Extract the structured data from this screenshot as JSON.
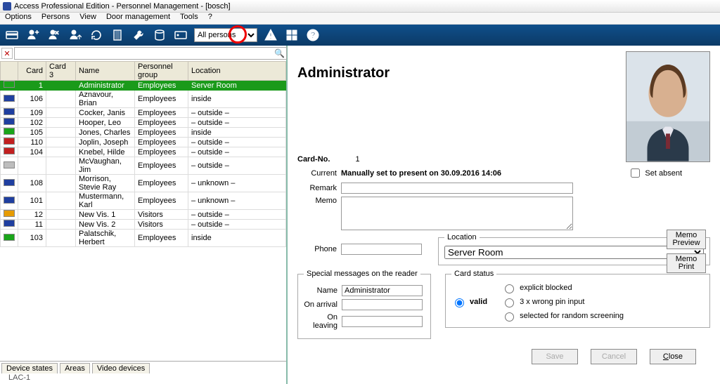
{
  "window": {
    "title": "Access Professional Edition - Personnel Management - [bosch]"
  },
  "menu": [
    "Options",
    "Persons",
    "View",
    "Door management",
    "Tools",
    "?"
  ],
  "toolbar": {
    "filter_selected": "All persons"
  },
  "columns": [
    "",
    "Card",
    "Card 3",
    "Name",
    "Personnel group",
    "Location"
  ],
  "rows": [
    {
      "sw": "#1aa51a",
      "card": "1",
      "card3": "",
      "name": "Administrator",
      "pg": "Employees",
      "loc": "Server Room",
      "sel": true
    },
    {
      "sw": "#1f3fa0",
      "card": "106",
      "card3": "",
      "name": "Aznavour, Brian",
      "pg": "Employees",
      "loc": "inside"
    },
    {
      "sw": "#1f3fa0",
      "card": "109",
      "card3": "",
      "name": "Cocker, Janis",
      "pg": "Employees",
      "loc": "– outside –"
    },
    {
      "sw": "#1f3fa0",
      "card": "102",
      "card3": "",
      "name": "Hooper, Leo",
      "pg": "Employees",
      "loc": "– outside –"
    },
    {
      "sw": "#1aa51a",
      "card": "105",
      "card3": "",
      "name": "Jones, Charles",
      "pg": "Employees",
      "loc": "inside"
    },
    {
      "sw": "#c22020",
      "card": "110",
      "card3": "",
      "name": "Joplin, Joseph",
      "pg": "Employees",
      "loc": "– outside –"
    },
    {
      "sw": "#c22020",
      "card": "104",
      "card3": "",
      "name": "Knebel, Hilde",
      "pg": "Employees",
      "loc": "– outside –"
    },
    {
      "sw": "#bdbdbd",
      "card": "",
      "card3": "",
      "name": "McVaughan, Jim",
      "pg": "Employees",
      "loc": "– outside –"
    },
    {
      "sw": "#1f3fa0",
      "card": "108",
      "card3": "",
      "name": "Morrison, Stevie Ray",
      "pg": "Employees",
      "loc": "– unknown –"
    },
    {
      "sw": "#1f3fa0",
      "card": "101",
      "card3": "",
      "name": "Mustermann, Karl",
      "pg": "Employees",
      "loc": "– unknown –"
    },
    {
      "sw": "#e69b00",
      "card": "12",
      "card3": "",
      "name": "New Vis. 1",
      "pg": "Visitors",
      "loc": "– outside –"
    },
    {
      "sw": "#1f3fa0",
      "card": "11",
      "card3": "",
      "name": "New Vis. 2",
      "pg": "Visitors",
      "loc": "– outside –"
    },
    {
      "sw": "#1aa51a",
      "card": "103",
      "card3": "",
      "name": "Palatschik, Herbert",
      "pg": "Employees",
      "loc": "inside"
    }
  ],
  "bottom_tabs": [
    "Device states",
    "Areas",
    "Video devices"
  ],
  "lac": "LAC-1",
  "detail": {
    "title": "Administrator",
    "cardno_label": "Card-No.",
    "cardno": "1",
    "current_label": "Current",
    "current_value": "Manually set to present on 30.09.2016 14:06",
    "set_absent": "Set absent",
    "remark_label": "Remark",
    "remark": "",
    "memo_label": "Memo",
    "memo": "",
    "memo_preview": "Memo\nPreview",
    "memo_print": "Memo\nPrint",
    "phone_label": "Phone",
    "phone": "",
    "location_legend": "Location",
    "location_value": "Server Room",
    "special_legend": "Special messages on the reader",
    "special_name_label": "Name",
    "special_name": "Administrator",
    "on_arrival_label": "On arrival",
    "on_arrival": "",
    "on_leaving_label": "On leaving",
    "on_leaving": "",
    "card_status_legend": "Card status",
    "valid_label": "valid",
    "cs1": "explicit blocked",
    "cs2": "3 x wrong pin input",
    "cs3": "selected for random screening",
    "save": "Save",
    "cancel": "Cancel",
    "close": "Close"
  }
}
